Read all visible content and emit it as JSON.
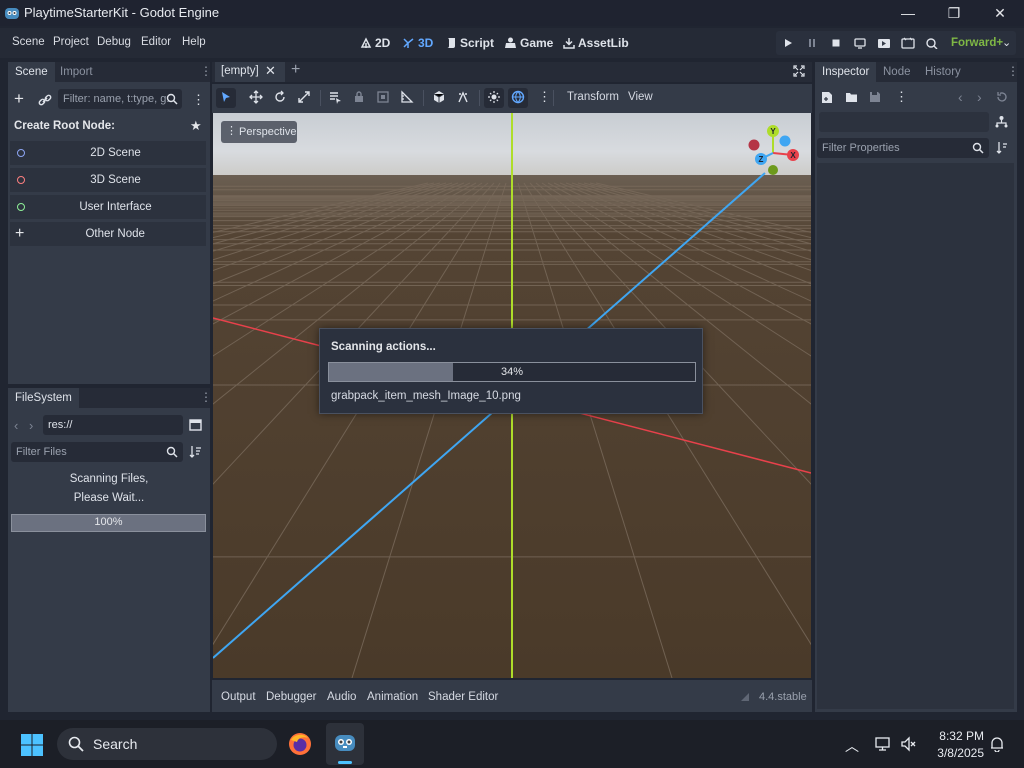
{
  "window": {
    "title": "PlaytimeStarterKit - Godot Engine",
    "minimize": "—",
    "maximize": "❐",
    "close": "✕"
  },
  "menu": [
    "Scene",
    "Project",
    "Debug",
    "Editor",
    "Help"
  ],
  "workspaces": [
    {
      "label": "2D",
      "icon": "2d-icon"
    },
    {
      "label": "3D",
      "icon": "3d-icon",
      "active": true
    },
    {
      "label": "Script",
      "icon": "script-icon"
    },
    {
      "label": "Game",
      "icon": "game-icon"
    },
    {
      "label": "AssetLib",
      "icon": "assetlib-icon"
    }
  ],
  "renderer": "Forward+",
  "scene_dock": {
    "tabs": [
      "Scene",
      "Import"
    ],
    "filter_placeholder": "Filter: name, t:type, g:",
    "create_root": "Create Root Node:",
    "buttons": [
      {
        "label": "2D Scene",
        "color": "#8da5f3"
      },
      {
        "label": "3D Scene",
        "color": "#fc7f7f"
      },
      {
        "label": "User Interface",
        "color": "#8eef97"
      },
      {
        "label": "Other Node",
        "color": "#e0e0e0"
      }
    ]
  },
  "filesystem": {
    "tab": "FileSystem",
    "path": "res://",
    "filter_placeholder": "Filter Files",
    "scanning_line1": "Scanning Files,",
    "scanning_line2": "Please Wait...",
    "progress": 100,
    "progress_label": "100%"
  },
  "editor_tabs": {
    "tab": "[empty]"
  },
  "viewport": {
    "toolbar_transform": "Transform",
    "toolbar_view": "View",
    "perspective": "Perspective",
    "gizmo_labels": {
      "y": "Y",
      "z": "Z",
      "x": "X"
    }
  },
  "dialog": {
    "title": "Scanning actions...",
    "progress": 34,
    "progress_label": "34%",
    "file": "grabpack_item_mesh_Image_10.png"
  },
  "bottom_panel": {
    "tabs": [
      "Output",
      "Debugger",
      "Audio",
      "Animation",
      "Shader Editor"
    ],
    "version": "4.4.stable"
  },
  "inspector": {
    "tabs": [
      "Inspector",
      "Node",
      "History"
    ],
    "filter_placeholder": "Filter Properties"
  },
  "taskbar": {
    "search": "Search",
    "time": "8:32 PM",
    "date": "3/8/2025"
  },
  "colors": {
    "accent": "#62a8ff",
    "bg": "#202531",
    "panel": "#343b48",
    "x_axis": "#e8414b",
    "y_axis": "#aedd2a",
    "z_axis": "#3fa6f2",
    "ground": "#4a3a29"
  }
}
